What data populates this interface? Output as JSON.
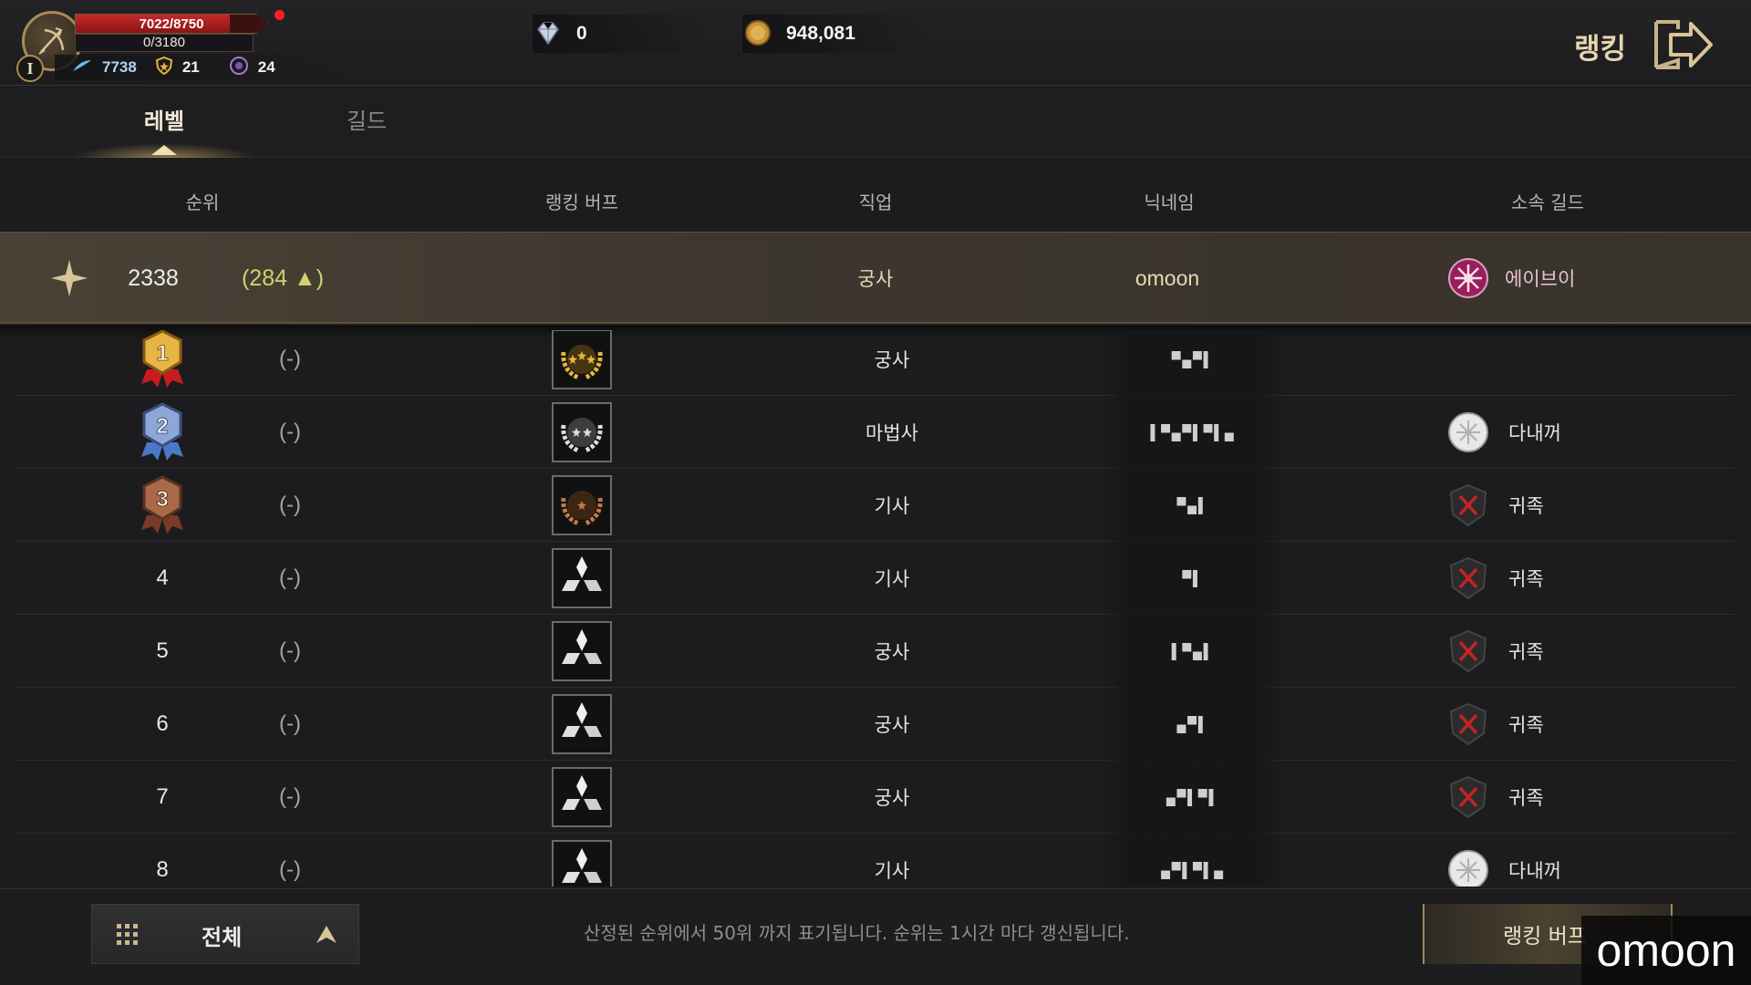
{
  "hud": {
    "hp_text": "7022/8750",
    "hp_fraction": 0.8025,
    "mp_text": "0/3180",
    "level_badge": "I",
    "stats": {
      "feather": "7738",
      "shield": "21",
      "orb": "24"
    },
    "currency": {
      "gem": "0",
      "gold": "948,081"
    },
    "title": "랭킹"
  },
  "tabs": [
    {
      "label": "레벨",
      "active": true
    },
    {
      "label": "길드",
      "active": false
    }
  ],
  "columns": {
    "rank": "순위",
    "buff": "랭킹 버프",
    "class": "직업",
    "nickname": "닉네임",
    "guild": "소속 길드"
  },
  "my_rank": {
    "rank": "2338",
    "change": "(284 ▲)",
    "class": "궁사",
    "nickname": "omoon",
    "guild": "에이브이"
  },
  "rows": [
    {
      "rank": "1",
      "change": "(-)",
      "buff_icon": "gold-laurel-crown-icon",
      "class": "궁사",
      "nickname": "▀▄▀▌",
      "guild": "",
      "guild_icon": ""
    },
    {
      "rank": "2",
      "change": "(-)",
      "buff_icon": "silver-laurel-crown-icon",
      "class": "마법사",
      "nickname": "▌▀▄▀▌▀▌▄",
      "guild": "다내꺼",
      "guild_icon": "white-guild-emblem-icon"
    },
    {
      "rank": "3",
      "change": "(-)",
      "buff_icon": "bronze-laurel-crown-icon",
      "class": "기사",
      "nickname": "▀▄▌",
      "guild": "귀족",
      "guild_icon": "red-x-shield-icon"
    },
    {
      "rank": "4",
      "change": "(-)",
      "buff_icon": "tri-diamond-icon",
      "class": "기사",
      "nickname": "▀▌",
      "guild": "귀족",
      "guild_icon": "red-x-shield-icon"
    },
    {
      "rank": "5",
      "change": "(-)",
      "buff_icon": "tri-diamond-icon",
      "class": "궁사",
      "nickname": "▌▀▄▌",
      "guild": "귀족",
      "guild_icon": "red-x-shield-icon"
    },
    {
      "rank": "6",
      "change": "(-)",
      "buff_icon": "tri-diamond-icon",
      "class": "궁사",
      "nickname": "▄▀▌",
      "guild": "귀족",
      "guild_icon": "red-x-shield-icon"
    },
    {
      "rank": "7",
      "change": "(-)",
      "buff_icon": "tri-diamond-icon",
      "class": "궁사",
      "nickname": "▄▀▌▀▌",
      "guild": "귀족",
      "guild_icon": "red-x-shield-icon"
    },
    {
      "rank": "8",
      "change": "(-)",
      "buff_icon": "tri-diamond-icon",
      "class": "기사",
      "nickname": "▄▀▌▀▌▄",
      "guild": "다내꺼",
      "guild_icon": "white-guild-emblem-icon"
    }
  ],
  "footer": {
    "filter_label": "전체",
    "notice": "산정된 순위에서 50위 까지 표기됩니다. 순위는 1시간 마다 갱신됩니다.",
    "buff_button": "랭킹 버프"
  },
  "watermark": "omoon",
  "colors": {
    "accent_gold": "#e4be6e",
    "hp_red": "#c52a2a",
    "rank_up": "#d6cf6f",
    "guild_pink": "#e7c3d8"
  }
}
